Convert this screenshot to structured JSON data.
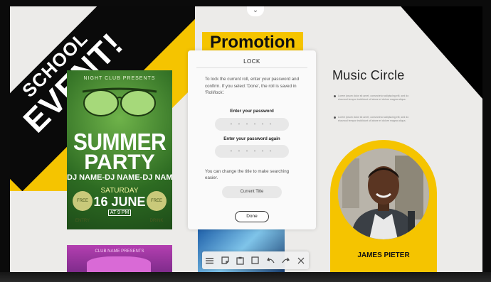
{
  "banner": {
    "line1": "SCHOOL",
    "line2": "EVENT!"
  },
  "poster_summer": {
    "presents": "NIGHT CLUB PRESENTS",
    "title_line1": "SUMMER",
    "title_line2": "PARTY",
    "djs": "DJ NAME-DJ NAME-DJ NAME",
    "day": "SATURDAY",
    "date": "16 JUNE",
    "time": "AT 9 PM",
    "badge_left": "FREE ENTRY",
    "badge_right": "FREE DRINK"
  },
  "poster_pink": {
    "presents": "CLUB NAME PRESENTS"
  },
  "promotion": {
    "title": "Promotion"
  },
  "lock_dialog": {
    "title": "LOCK",
    "description": "To lock the current roll, enter your password and confirm. If you select 'Done', the roll is saved in 'Roll/lock'.",
    "password_label": "Enter your password",
    "password_mask": "• • • • • •",
    "confirm_label": "Enter your password again",
    "confirm_mask": "• • • • • •",
    "note": "You can change the title to make searching easier.",
    "title_button": "Current Title",
    "done_button": "Done"
  },
  "music": {
    "title": "Music Circle",
    "bullet1": "Lorem ipsum dolor sit amet, consectetur adipiscing elit, sed do eiusmod tempor incididunt ut labore et dolore magna aliqua.",
    "bullet2": "Lorem ipsum dolor sit amet, consectetur adipiscing elit, sed do eiusmod tempor incididunt ut labore et dolore magna aliqua."
  },
  "profile": {
    "name": "JAMES PIETER"
  },
  "toolbar": {
    "icons": [
      "menu-icon",
      "sticky-note-icon",
      "paste-icon",
      "select-icon",
      "undo-icon",
      "redo-icon",
      "close-icon"
    ]
  },
  "colors": {
    "accent": "#f5c400",
    "banner_black": "#0a0a0a",
    "canvas": "#ecebe9"
  }
}
